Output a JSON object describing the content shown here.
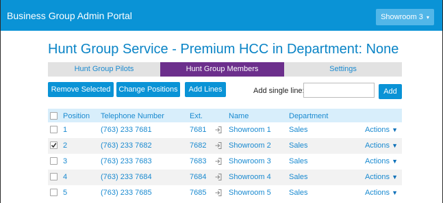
{
  "header": {
    "app_title": "Business Group Admin Portal",
    "location_label": "Showroom 3",
    "caret": "▾"
  },
  "page": {
    "title": "Hunt Group Service - Premium HCC in Department: None"
  },
  "tabs": [
    {
      "label": "Hunt Group Pilots",
      "active": false
    },
    {
      "label": "Hunt Group Members",
      "active": true
    },
    {
      "label": "Settings",
      "active": false
    }
  ],
  "toolbar": {
    "remove_label": "Remove Selected",
    "change_label": "Change Positions",
    "add_lines_label": "Add Lines",
    "add_single_label": "Add single line:",
    "add_single_value": "",
    "add_label": "Add"
  },
  "table": {
    "headers": {
      "position": "Position",
      "telephone": "Telephone Number",
      "ext": "Ext.",
      "name": "Name",
      "department": "Department"
    },
    "rows": [
      {
        "checked": false,
        "position": "1",
        "telephone": "(763) 233 7681",
        "ext": "7681",
        "name": "Showroom 1",
        "department": "Sales",
        "actions": "Actions",
        "arrow": "▼"
      },
      {
        "checked": true,
        "position": "2",
        "telephone": "(763) 233 7682",
        "ext": "7682",
        "name": "Showroom 2",
        "department": "Sales",
        "actions": "Actions",
        "arrow": "▼"
      },
      {
        "checked": false,
        "position": "3",
        "telephone": "(763) 233 7683",
        "ext": "7683",
        "name": "Showroom 3",
        "department": "Sales",
        "actions": "Actions",
        "arrow": "▼"
      },
      {
        "checked": false,
        "position": "4",
        "telephone": "(763) 233 7684",
        "ext": "7684",
        "name": "Showroom 4",
        "department": "Sales",
        "actions": "Actions",
        "arrow": "▼"
      },
      {
        "checked": false,
        "position": "5",
        "telephone": "(763) 233 7685",
        "ext": "7685",
        "name": "Showroom 5",
        "department": "Sales",
        "actions": "Actions",
        "arrow": "▼"
      }
    ]
  },
  "colors": {
    "brand": "#0a93d6",
    "active_tab": "#6c2f8c",
    "link": "#1a8ad0"
  }
}
